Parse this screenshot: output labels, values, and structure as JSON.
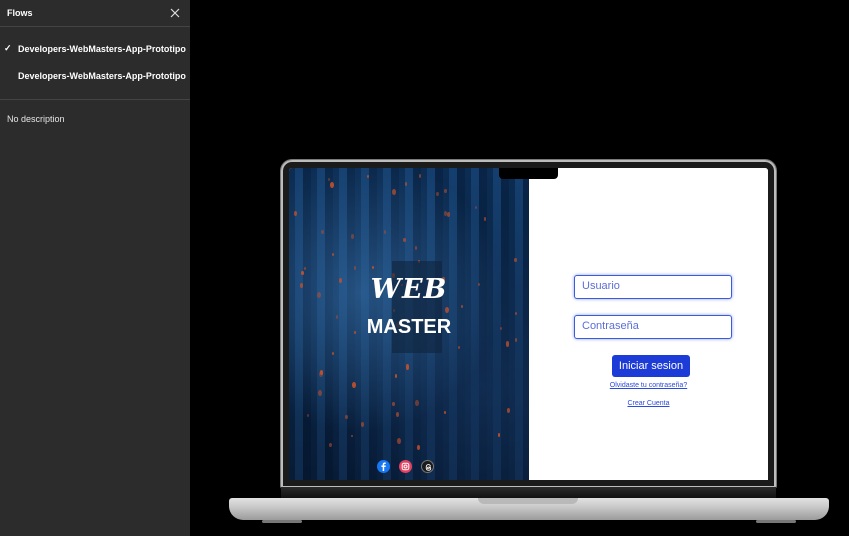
{
  "sidebar": {
    "title": "Flows",
    "flows": [
      {
        "label": "Developers-WebMasters-App-Prototipo",
        "selected": true
      },
      {
        "label": "Developers-WebMasters-App-Prototipo",
        "selected": false
      }
    ],
    "description": "No description"
  },
  "prototype": {
    "logo_line1": "WEB",
    "logo_line2": "MASTER",
    "username_placeholder": "Usuario",
    "password_placeholder": "Contraseña",
    "login_label": "Iniciar sesion",
    "forgot_label": "Olvidaste tu contraseña?",
    "create_label": "Crear Cuenta",
    "socials": [
      "facebook-icon",
      "instagram-icon",
      "threads-icon"
    ]
  },
  "colors": {
    "accent": "#1d3bd6",
    "sidebar_bg": "#2c2c2c"
  }
}
